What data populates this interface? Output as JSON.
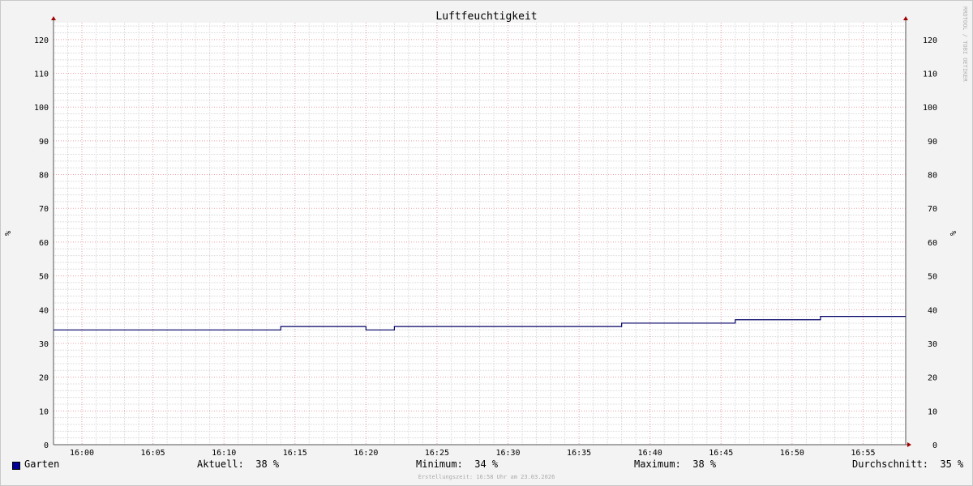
{
  "chart_data": {
    "type": "line",
    "title": "Luftfeuchtigkeit",
    "ylabel": "%",
    "ylabel_right": "%",
    "watermark": "RRDTOOL / TOBI OETIKER",
    "x_range": [
      "15:58",
      "16:58"
    ],
    "ylim": [
      0,
      125
    ],
    "y_ticks": [
      0,
      10,
      20,
      30,
      40,
      50,
      60,
      70,
      80,
      90,
      100,
      110,
      120
    ],
    "x_ticks": [
      "16:00",
      "16:05",
      "16:10",
      "16:15",
      "16:20",
      "16:25",
      "16:30",
      "16:35",
      "16:40",
      "16:45",
      "16:50",
      "16:55"
    ],
    "grid": true,
    "series": [
      {
        "name": "Garten",
        "color": "#000066",
        "interpolation": "step",
        "points": [
          [
            "15:58",
            34
          ],
          [
            "16:14",
            35
          ],
          [
            "16:20",
            34
          ],
          [
            "16:22",
            35
          ],
          [
            "16:38",
            36
          ],
          [
            "16:46",
            37
          ],
          [
            "16:52",
            38
          ],
          [
            "16:58",
            38
          ]
        ]
      }
    ]
  },
  "legend": {
    "series_name": "Garten",
    "swatch_color": "#000099",
    "current": "Aktuell:  38 %",
    "minimum": "Minimum:  34 %",
    "maximum": "Maximum:  38 %",
    "average": "Durchschnitt:  35 %"
  },
  "footer": "Erstellungszeit: 16:58 Uhr am 23.03.2026"
}
